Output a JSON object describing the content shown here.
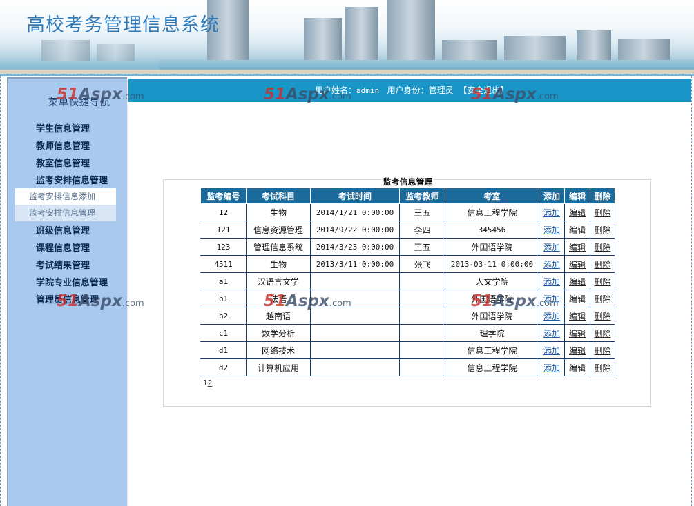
{
  "header": {
    "title": "高校考务管理信息系统"
  },
  "sidebar": {
    "title": "菜单快捷导航",
    "items": [
      {
        "label": "学生信息管理"
      },
      {
        "label": "教师信息管理"
      },
      {
        "label": "教室信息管理"
      },
      {
        "label": "监考安排信息管理"
      },
      {
        "label": "班级信息管理"
      },
      {
        "label": "课程信息管理"
      },
      {
        "label": "考试结果管理"
      },
      {
        "label": "学院专业信息管理"
      },
      {
        "label": "管理员信息管理"
      }
    ],
    "subitems": [
      {
        "label": "监考安排信息添加"
      },
      {
        "label": "监考安排信息管理"
      }
    ]
  },
  "infobar": {
    "user_label": "用户姓名：",
    "user_name": "admin",
    "role_label": "用户身份：",
    "role": "管理员",
    "logout": "【安全退出】"
  },
  "watermark": {
    "num": "51",
    "brand": "Aspx",
    "tld": ".com"
  },
  "panel": {
    "title": "监考信息管理"
  },
  "table": {
    "headers": [
      "监考编号",
      "考试科目",
      "考试时间",
      "监考教师",
      "考室",
      "添加",
      "编辑",
      "删除"
    ],
    "action_labels": {
      "add": "添加",
      "edit": "编辑",
      "delete": "删除"
    },
    "rows": [
      {
        "id": "12",
        "subject": "生物",
        "time": "2014/1/21 0:00:00",
        "teacher": "王五",
        "room": "信息工程学院"
      },
      {
        "id": "121",
        "subject": "信息资源管理",
        "time": "2014/9/22 0:00:00",
        "teacher": "李四",
        "room": "345456"
      },
      {
        "id": "123",
        "subject": "管理信息系统",
        "time": "2014/3/23 0:00:00",
        "teacher": "王五",
        "room": "外国语学院"
      },
      {
        "id": "4511",
        "subject": "生物",
        "time": "2013/3/11 0:00:00",
        "teacher": "张飞",
        "room": "2013-03-11 0:00:00"
      },
      {
        "id": "a1",
        "subject": "汉语言文学",
        "time": "",
        "teacher": "",
        "room": "人文学院"
      },
      {
        "id": "b1",
        "subject": "法语",
        "time": "",
        "teacher": "",
        "room": "外国语学院"
      },
      {
        "id": "b2",
        "subject": "越南语",
        "time": "",
        "teacher": "",
        "room": "外国语学院"
      },
      {
        "id": "c1",
        "subject": "数学分析",
        "time": "",
        "teacher": "",
        "room": "理学院"
      },
      {
        "id": "d1",
        "subject": "网络技术",
        "time": "",
        "teacher": "",
        "room": "信息工程学院"
      },
      {
        "id": "d2",
        "subject": "计算机应用",
        "time": "",
        "teacher": "",
        "room": "信息工程学院"
      }
    ]
  },
  "pager": {
    "current": "1",
    "next": "2"
  }
}
